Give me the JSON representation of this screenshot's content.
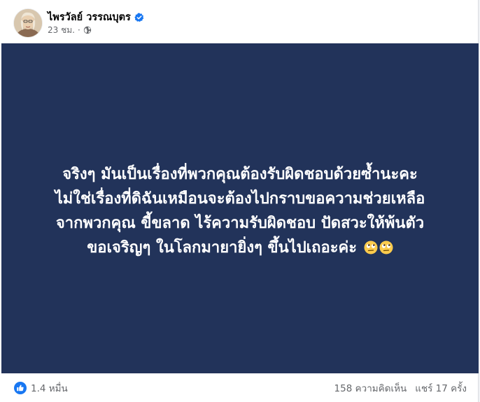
{
  "post": {
    "author": "ไพรวัลย์ วรรณบุตร",
    "verified_icon": "verified-badge-icon",
    "time": "23 ชม.",
    "separator": "·",
    "audience_icon": "globe-icon",
    "text_lines": [
      "จริงๆ มันเป็นเรื่องที่พวกคุณต้องรับผิดชอบด้วยซ้ำนะคะ",
      "ไม่ใช่เรื่องที่ดิฉันเหมือนจะต้องไปกราบขอความช่วยเหลือ",
      "จากพวกคุณ ขี้ขลาด ไร้ความรับผิดชอบ ปัดสวะให้พ้นตัว",
      "ขอเจริญๆ ในโลกมายายิ่งๆ ขึ้นไปเถอะค่ะ"
    ],
    "emojis": [
      "face-with-rolling-eyes",
      "face-with-rolling-eyes"
    ],
    "image_background": "#22335a"
  },
  "footer": {
    "reaction_icon": "like-icon",
    "reaction_count": "1.4 หมื่น",
    "comments": "158 ความคิดเห็น",
    "shares": "แชร์ 17 ครั้ง"
  },
  "colors": {
    "brand_blue": "#1877f2",
    "text_primary": "#050505",
    "text_secondary": "#65676b",
    "image_bg": "#22335a"
  }
}
